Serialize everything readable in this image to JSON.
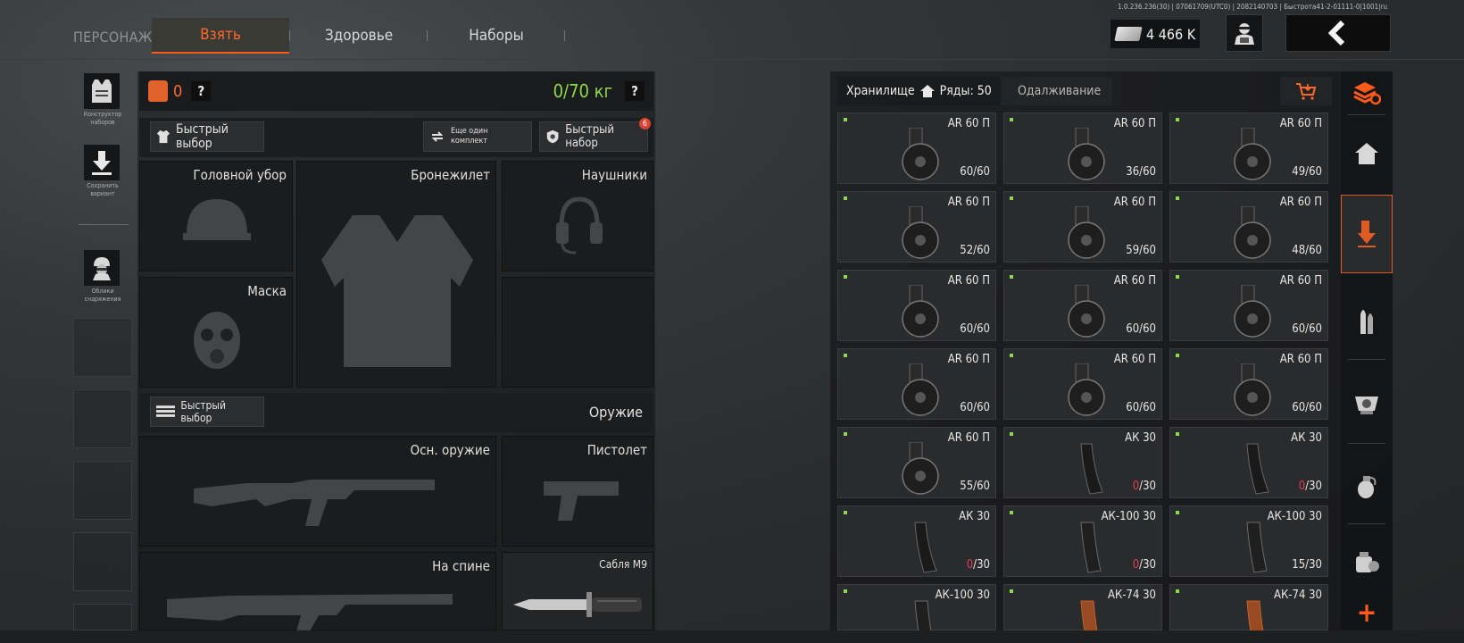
{
  "version": "1.0.236.236(30) | 07061709(UTC0) | 2082140703 | Быстрота41-2-01111-0|1001|ru",
  "nav": {
    "persona_label": "ПЕРСОНАЖ",
    "tabs": [
      {
        "label": "Взять",
        "active": true
      },
      {
        "label": "Здоровье",
        "active": false
      },
      {
        "label": "Наборы",
        "active": false
      }
    ]
  },
  "currency": {
    "amount": "4 466 K",
    "icon": "cash-icon"
  },
  "side": {
    "constructor_label": "Конструктор наборов",
    "save_label": "Сохранить вариант",
    "skins_label": "Облики снаряжения"
  },
  "equipment": {
    "backpack_count": "0",
    "help_symbol": "?",
    "weight": "0/70 кг",
    "quick_select_label": "Быстрый выбор",
    "another_set_label": "Еще один комплект",
    "quick_set_label": "Быстрый набор",
    "quick_set_badge": "6",
    "slots": {
      "headgear": "Головной убор",
      "vest": "Бронежилет",
      "headphones": "Наушники",
      "mask": "Маска"
    },
    "weapons_quick_select_label": "Быстрый выбор",
    "weapons_title": "Оружие",
    "weapon_slots": {
      "primary": "Осн. оружие",
      "pistol": "Пистолет",
      "back": "На спине",
      "melee": "Сабля М9"
    }
  },
  "storage": {
    "tab_storage": "Хранилище",
    "rows_label": "Ряды: 50",
    "tab_lending": "Одалживание",
    "items": [
      {
        "name": "AR 60 П",
        "count": "60",
        "cap": "60",
        "kind": "drum"
      },
      {
        "name": "AR 60 П",
        "count": "36",
        "cap": "60",
        "kind": "drum"
      },
      {
        "name": "AR 60 П",
        "count": "49",
        "cap": "60",
        "kind": "drum"
      },
      {
        "name": "AR 60 П",
        "count": "52",
        "cap": "60",
        "kind": "drum"
      },
      {
        "name": "AR 60 П",
        "count": "59",
        "cap": "60",
        "kind": "drum"
      },
      {
        "name": "AR 60 П",
        "count": "48",
        "cap": "60",
        "kind": "drum"
      },
      {
        "name": "AR 60 П",
        "count": "60",
        "cap": "60",
        "kind": "drum"
      },
      {
        "name": "AR 60 П",
        "count": "60",
        "cap": "60",
        "kind": "drum"
      },
      {
        "name": "AR 60 П",
        "count": "60",
        "cap": "60",
        "kind": "drum"
      },
      {
        "name": "AR 60 П",
        "count": "60",
        "cap": "60",
        "kind": "drum"
      },
      {
        "name": "AR 60 П",
        "count": "60",
        "cap": "60",
        "kind": "drum"
      },
      {
        "name": "AR 60 П",
        "count": "60",
        "cap": "60",
        "kind": "drum"
      },
      {
        "name": "AR 60 П",
        "count": "55",
        "cap": "60",
        "kind": "drum"
      },
      {
        "name": "АК 30",
        "count": "0",
        "cap": "30",
        "kind": "curved"
      },
      {
        "name": "АК 30",
        "count": "0",
        "cap": "30",
        "kind": "curved"
      },
      {
        "name": "АК 30",
        "count": "0",
        "cap": "30",
        "kind": "curved"
      },
      {
        "name": "АК-100 30",
        "count": "0",
        "cap": "30",
        "kind": "straight"
      },
      {
        "name": "АК-100 30",
        "count": "15",
        "cap": "30",
        "kind": "straight"
      },
      {
        "name": "АК-100 30",
        "count": "",
        "cap": "",
        "kind": "straight"
      },
      {
        "name": "АК-74 30",
        "count": "",
        "cap": "",
        "kind": "orange"
      },
      {
        "name": "АК-74 30",
        "count": "",
        "cap": "",
        "kind": "orange"
      }
    ]
  },
  "rail": {
    "items": [
      "sets-refresh-icon",
      "home-icon",
      "download-icon",
      "ammo-icon",
      "sight-icon",
      "grenade-icon",
      "backpack-gear-icon",
      "add-icon"
    ],
    "add_symbol": "+"
  },
  "colors": {
    "accent": "#ff5a1a",
    "green": "#8fd94e",
    "red": "#e0405a"
  }
}
